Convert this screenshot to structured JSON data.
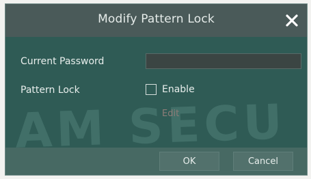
{
  "dialog": {
    "title": "Modify Pattern Lock",
    "close_icon": "close-icon",
    "watermark": "AM SECU"
  },
  "fields": {
    "current_password_label": "Current Password",
    "current_password_value": "",
    "pattern_lock_label": "Pattern Lock",
    "enable_label": "Enable",
    "enable_checked": false,
    "edit_label": "Edit"
  },
  "buttons": {
    "ok_label": "OK",
    "cancel_label": "Cancel"
  },
  "colors": {
    "titlebar": "#4a5a59",
    "body": "#2f5b55",
    "footer": "#476963",
    "disabled_text": "#8e7d78"
  }
}
